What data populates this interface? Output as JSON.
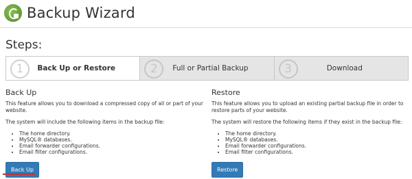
{
  "header": {
    "title": "Backup Wizard",
    "logo_icon": "backup-wizard-logo-icon"
  },
  "steps_label": "Steps:",
  "steps": [
    {
      "number": "1",
      "label": "Back Up or Restore",
      "active": true
    },
    {
      "number": "2",
      "label": "Full or Partial Backup",
      "active": false
    },
    {
      "number": "3",
      "label": "Download",
      "active": false
    }
  ],
  "backup": {
    "heading": "Back Up",
    "description": "This feature allows you to download a compressed copy of all or part of your website.",
    "list_intro": "The system will include the following items in the backup file:",
    "items": [
      "The home directory.",
      "MySQL® databases.",
      "Email forwarder configurations.",
      "Email filter configurations."
    ],
    "button_label": "Back Up"
  },
  "restore": {
    "heading": "Restore",
    "description": "This feature allows you to upload an existing partial backup file in order to restore parts of your website.",
    "list_intro": "The system will restore the following items if they exist in the backup file:",
    "items": [
      "The home directory.",
      "MySQL® databases.",
      "Email forwarder configurations.",
      "Email filter configurations."
    ],
    "button_label": "Restore"
  },
  "colors": {
    "accent": "#337ab7",
    "highlight": "#c9302c",
    "logo": "#5f9a35"
  }
}
